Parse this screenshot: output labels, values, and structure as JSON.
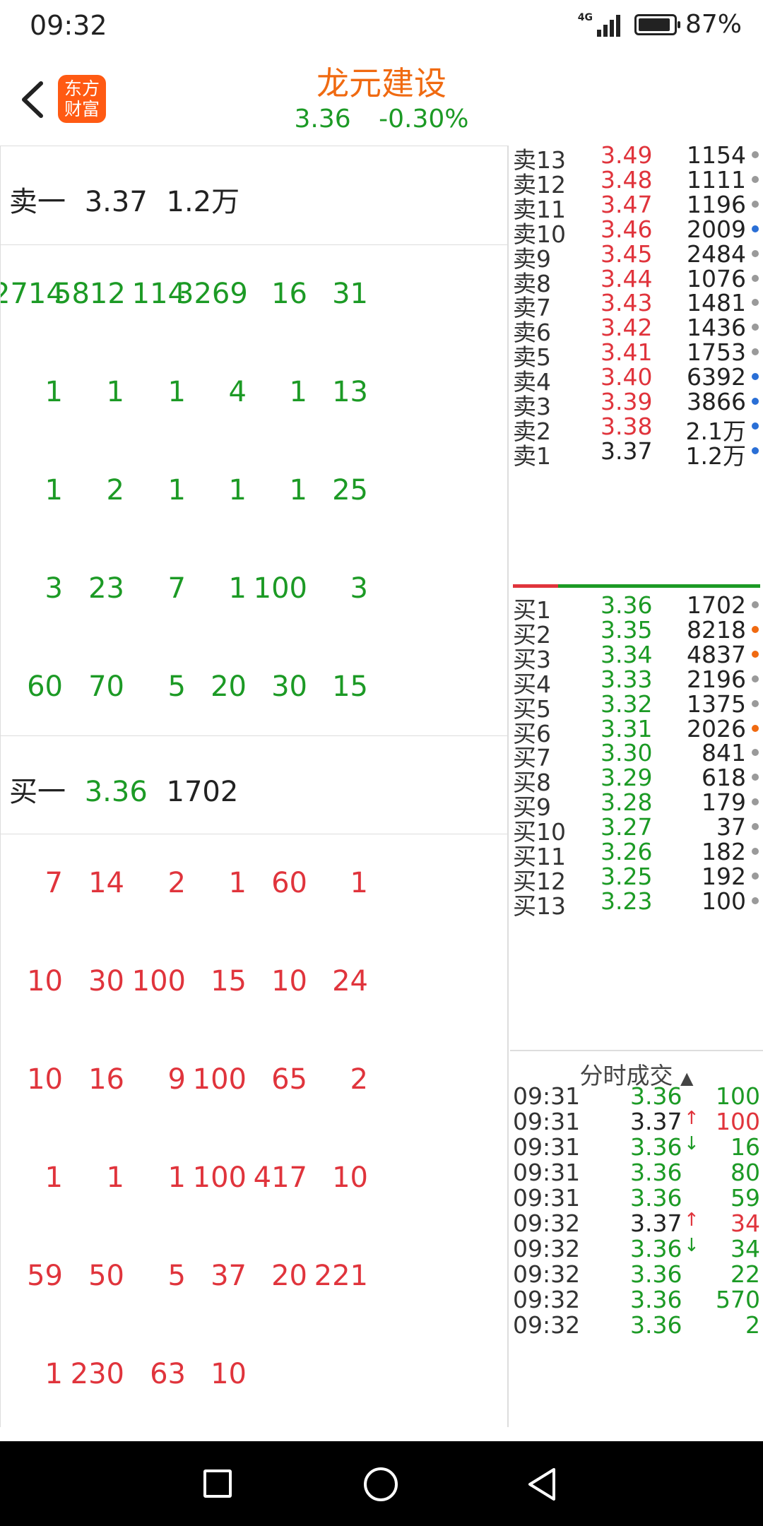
{
  "status_bar": {
    "time": "09:32",
    "network": "4G",
    "battery": "87%"
  },
  "header": {
    "logo_text": "东方财富",
    "logo_line1": "东方",
    "logo_line2": "财富",
    "stock_name": "龙元建设",
    "price": "3.36",
    "change": "-0.30%"
  },
  "left_panel": {
    "sell_header": {
      "label": "卖一",
      "price": "3.37",
      "volume": "1.2万"
    },
    "sell_queue": [
      [
        "2714",
        "5812",
        "114",
        "3269",
        "16",
        "31"
      ],
      [
        "1",
        "1",
        "1",
        "4",
        "1",
        "13"
      ],
      [
        "1",
        "2",
        "1",
        "1",
        "1",
        "25"
      ],
      [
        "3",
        "23",
        "7",
        "1",
        "100",
        "3"
      ],
      [
        "60",
        "70",
        "5",
        "20",
        "30",
        "15"
      ]
    ],
    "buy_header": {
      "label": "买一",
      "price": "3.36",
      "volume": "1702"
    },
    "buy_queue": [
      [
        "7",
        "14",
        "2",
        "1",
        "60",
        "1"
      ],
      [
        "10",
        "30",
        "100",
        "15",
        "10",
        "24"
      ],
      [
        "10",
        "16",
        "9",
        "100",
        "65",
        "2"
      ],
      [
        "1",
        "1",
        "1",
        "100",
        "417",
        "10"
      ],
      [
        "59",
        "50",
        "5",
        "37",
        "20",
        "221"
      ],
      [
        "1",
        "230",
        "63",
        "10",
        "",
        ""
      ]
    ]
  },
  "order_book": {
    "asks": [
      {
        "label": "卖13",
        "price": "3.49",
        "volume": "1154",
        "dot": "gray"
      },
      {
        "label": "卖12",
        "price": "3.48",
        "volume": "1111",
        "dot": "gray"
      },
      {
        "label": "卖11",
        "price": "3.47",
        "volume": "1196",
        "dot": "gray"
      },
      {
        "label": "卖10",
        "price": "3.46",
        "volume": "2009",
        "dot": "blue"
      },
      {
        "label": "卖9",
        "price": "3.45",
        "volume": "2484",
        "dot": "gray"
      },
      {
        "label": "卖8",
        "price": "3.44",
        "volume": "1076",
        "dot": "gray"
      },
      {
        "label": "卖7",
        "price": "3.43",
        "volume": "1481",
        "dot": "gray"
      },
      {
        "label": "卖6",
        "price": "3.42",
        "volume": "1436",
        "dot": "gray"
      },
      {
        "label": "卖5",
        "price": "3.41",
        "volume": "1753",
        "dot": "gray"
      },
      {
        "label": "卖4",
        "price": "3.40",
        "volume": "6392",
        "dot": "blue"
      },
      {
        "label": "卖3",
        "price": "3.39",
        "volume": "3866",
        "dot": "blue"
      },
      {
        "label": "卖2",
        "price": "3.38",
        "volume": "2.1万",
        "dot": "blue"
      },
      {
        "label": "卖1",
        "price": "3.37",
        "volume": "1.2万",
        "dot": "blue"
      }
    ],
    "bids": [
      {
        "label": "买1",
        "price": "3.36",
        "volume": "1702",
        "dot": "gray"
      },
      {
        "label": "买2",
        "price": "3.35",
        "volume": "8218",
        "dot": "orange"
      },
      {
        "label": "买3",
        "price": "3.34",
        "volume": "4837",
        "dot": "orange"
      },
      {
        "label": "买4",
        "price": "3.33",
        "volume": "2196",
        "dot": "gray"
      },
      {
        "label": "买5",
        "price": "3.32",
        "volume": "1375",
        "dot": "gray"
      },
      {
        "label": "买6",
        "price": "3.31",
        "volume": "2026",
        "dot": "orange"
      },
      {
        "label": "买7",
        "price": "3.30",
        "volume": "841",
        "dot": "gray"
      },
      {
        "label": "买8",
        "price": "3.29",
        "volume": "618",
        "dot": "gray"
      },
      {
        "label": "买9",
        "price": "3.28",
        "volume": "179",
        "dot": "gray"
      },
      {
        "label": "买10",
        "price": "3.27",
        "volume": "37",
        "dot": "gray"
      },
      {
        "label": "买11",
        "price": "3.26",
        "volume": "182",
        "dot": "gray"
      },
      {
        "label": "买12",
        "price": "3.25",
        "volume": "192",
        "dot": "gray"
      },
      {
        "label": "买13",
        "price": "3.23",
        "volume": "100",
        "dot": "gray"
      }
    ]
  },
  "trades": {
    "title": "分时成交",
    "rows": [
      {
        "time": "09:31",
        "price": "3.36",
        "arrow": "",
        "volume": "100",
        "dir": "buy"
      },
      {
        "time": "09:31",
        "price": "3.37",
        "arrow": "↑",
        "volume": "100",
        "dir": "sell"
      },
      {
        "time": "09:31",
        "price": "3.36",
        "arrow": "↓",
        "volume": "16",
        "dir": "buy"
      },
      {
        "time": "09:31",
        "price": "3.36",
        "arrow": "",
        "volume": "80",
        "dir": "buy"
      },
      {
        "time": "09:31",
        "price": "3.36",
        "arrow": "",
        "volume": "59",
        "dir": "buy"
      },
      {
        "time": "09:32",
        "price": "3.37",
        "arrow": "↑",
        "volume": "34",
        "dir": "sell"
      },
      {
        "time": "09:32",
        "price": "3.36",
        "arrow": "↓",
        "volume": "34",
        "dir": "buy"
      },
      {
        "time": "09:32",
        "price": "3.36",
        "arrow": "",
        "volume": "22",
        "dir": "buy"
      },
      {
        "time": "09:32",
        "price": "3.36",
        "arrow": "",
        "volume": "570",
        "dir": "buy"
      },
      {
        "time": "09:32",
        "price": "3.36",
        "arrow": "",
        "volume": "2",
        "dir": "buy"
      }
    ]
  },
  "colors": {
    "up": "#e0343c",
    "down": "#1c9a25",
    "accent": "#f06a11",
    "logo_bg": "#ff5a13"
  }
}
